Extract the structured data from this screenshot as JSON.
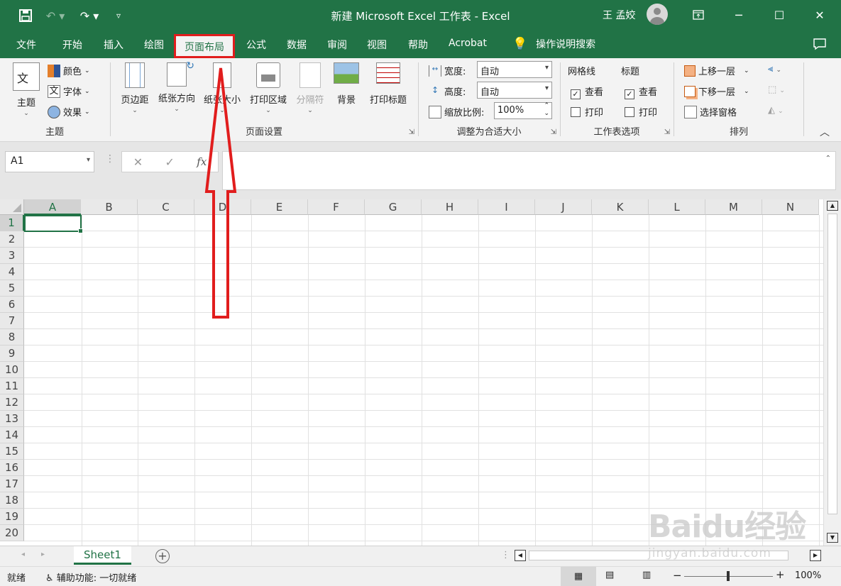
{
  "titlebar": {
    "title": "新建 Microsoft Excel 工作表  -  Excel",
    "user": "王 孟姣",
    "icons": [
      "save-icon",
      "undo-icon",
      "redo-icon",
      "customize-icon",
      "ribbon-display-icon",
      "minimize-icon",
      "maximize-icon",
      "close-icon"
    ],
    "accent": "#217346"
  },
  "tabs": {
    "items": [
      "文件",
      "开始",
      "插入",
      "绘图",
      "页面布局",
      "公式",
      "数据",
      "审阅",
      "视图",
      "帮助",
      "Acrobat"
    ],
    "active": "页面布局",
    "search": "操作说明搜索",
    "highlight_color": "#e11d1d"
  },
  "ribbon": {
    "themes": {
      "label": "主题",
      "theme_btn": "主题",
      "colors": "颜色",
      "fonts": "字体",
      "effects": "效果"
    },
    "page_setup": {
      "label": "页面设置",
      "margins": "页边距",
      "orientation": "纸张方向",
      "size": "纸张大小",
      "print_area": "打印区域",
      "breaks": "分隔符",
      "background": "背景",
      "print_titles": "打印标题"
    },
    "scale": {
      "label": "调整为合适大小",
      "width_label": "宽度:",
      "width_value": "自动",
      "height_label": "高度:",
      "height_value": "自动",
      "scale_label": "缩放比例:",
      "scale_value": "100%"
    },
    "sheet_options": {
      "label": "工作表选项",
      "gridlines": "网格线",
      "headings": "标题",
      "view": "查看",
      "print": "打印",
      "gridlines_view": true,
      "gridlines_print": false,
      "headings_view": true,
      "headings_print": false
    },
    "arrange": {
      "label": "排列",
      "bring_forward": "上移一层",
      "send_backward": "下移一层",
      "selection_pane": "选择窗格"
    }
  },
  "formula_bar": {
    "name_box": "A1",
    "fx": "fx",
    "content": ""
  },
  "grid": {
    "columns": [
      "A",
      "B",
      "C",
      "D",
      "E",
      "F",
      "G",
      "H",
      "I",
      "J",
      "K",
      "L",
      "M",
      "N"
    ],
    "rows": [
      "1",
      "2",
      "3",
      "4",
      "5",
      "6",
      "7",
      "8",
      "9",
      "10",
      "11",
      "12",
      "13",
      "14",
      "15",
      "16",
      "17",
      "18",
      "19",
      "20"
    ],
    "selected": "A1"
  },
  "sheets": {
    "tabs": [
      "Sheet1"
    ],
    "active": "Sheet1"
  },
  "status": {
    "ready": "就绪",
    "accessibility": "辅助功能: 一切就绪",
    "zoom": "100%"
  },
  "watermark": {
    "logo": "Baidu经验",
    "url": "jingyan.baidu.com"
  }
}
